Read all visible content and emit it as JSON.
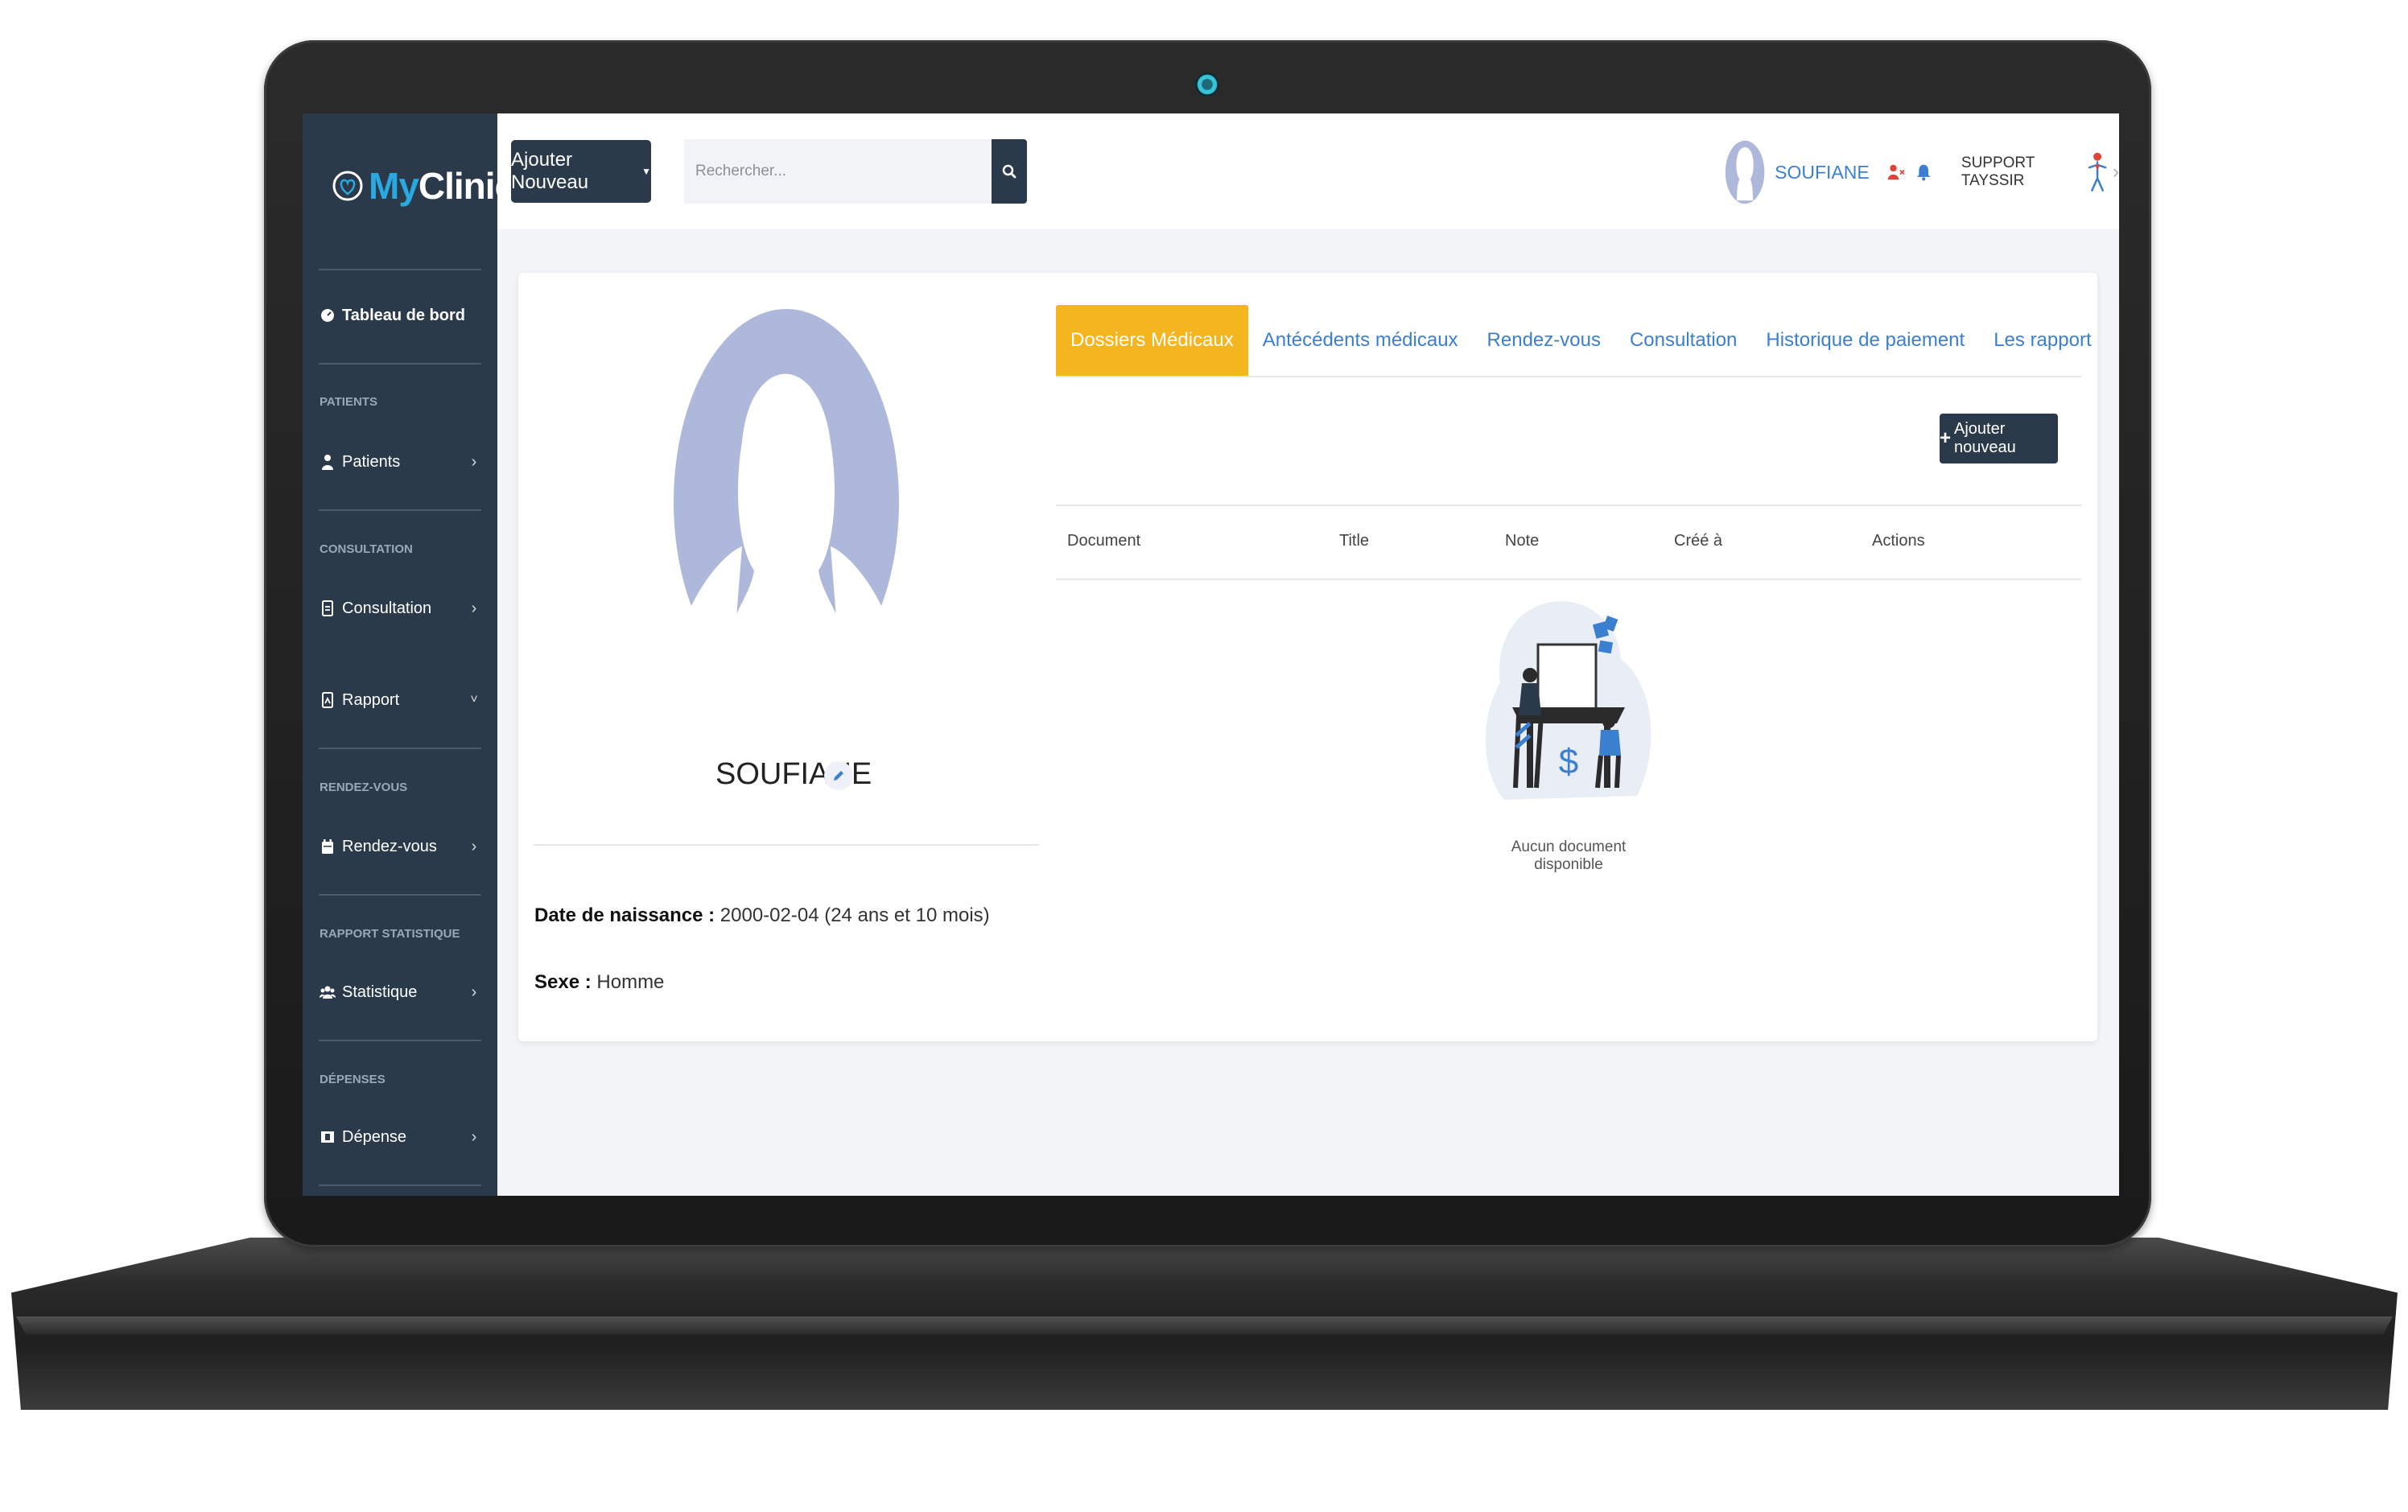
{
  "sidebar": {
    "logo": {
      "my": "My",
      "clinic": "Clinic"
    },
    "items": [
      {
        "label": "Tableau de bord"
      },
      {
        "section": "PATIENTS",
        "label": "Patients"
      },
      {
        "section": "CONSULTATION",
        "label": "Consultation"
      },
      {
        "label": "Rapport"
      },
      {
        "section": "RENDEZ-VOUS",
        "label": "Rendez-vous"
      },
      {
        "section": "RAPPORT STATISTIQUE",
        "label": "Statistique"
      },
      {
        "section": "DÉPENSES",
        "label": "Dépense"
      }
    ]
  },
  "topbar": {
    "add_new_label": "Ajouter Nouveau",
    "search_placeholder": "Rechercher...",
    "user_name": "SOUFIANE",
    "support_label": "SUPPORT TAYSSIR"
  },
  "profile": {
    "name": "SOUFIANE",
    "birth_label": "Date de naissance :",
    "birth_value": "2000-02-04 (24 ans et 10 mois)",
    "sex_label": "Sexe :",
    "sex_value": "Homme"
  },
  "tabs": [
    {
      "label": "Dossiers Médicaux",
      "active": true
    },
    {
      "label": "Antécédents médicaux"
    },
    {
      "label": "Rendez-vous"
    },
    {
      "label": "Consultation"
    },
    {
      "label": "Historique de paiement"
    },
    {
      "label": "Les rapport"
    }
  ],
  "documents": {
    "add_label": "Ajouter nouveau",
    "columns": [
      "Document",
      "Title",
      "Note",
      "Créé à",
      "Actions"
    ],
    "empty_text": "Aucun document disponible"
  },
  "colors": {
    "sidebar_bg": "#2b3a4a",
    "accent_blue": "#3a7fd0",
    "active_tab": "#f5b51e",
    "avatar": "#aeb8da"
  }
}
